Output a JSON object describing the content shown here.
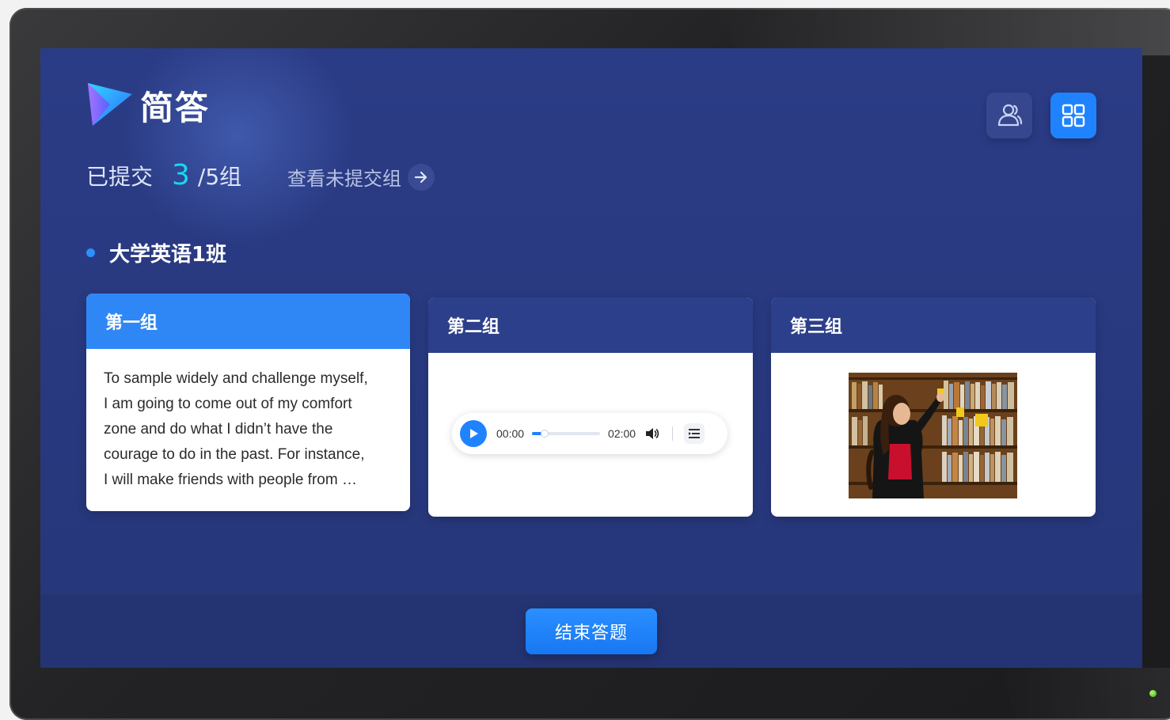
{
  "header": {
    "title": "简答"
  },
  "toolbar": {
    "members_icon": "users-icon",
    "grid_icon": "grid-icon"
  },
  "submission": {
    "label": "已提交",
    "submitted_count": "3",
    "total": "/5组",
    "view_unsubmitted": "查看未提交组"
  },
  "class": {
    "name": "大学英语1班"
  },
  "groups": [
    {
      "name": "第一组",
      "lines": [
        "To sample widely and challenge myself,",
        "I am going to come out of my comfort",
        "zone and do what I didn’t have the",
        "courage to do in the past. For instance,",
        "I will make friends with people from …"
      ]
    },
    {
      "name": "第二组",
      "audio": {
        "current_time": "00:00",
        "duration": "02:00",
        "progress": 0.18
      }
    },
    {
      "name": "第三组",
      "image": {
        "icon": "photo-girl-bookshelf"
      }
    }
  ],
  "footer": {
    "end_button": "结束答题"
  },
  "colors": {
    "accent": "#1f83ff",
    "count": "#17d8f0",
    "screen_bg": "#2a3a82"
  }
}
